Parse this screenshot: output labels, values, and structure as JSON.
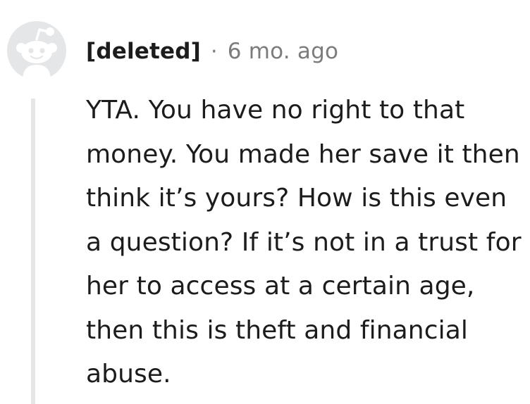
{
  "comment": {
    "author": "[deleted]",
    "separator": "·",
    "timestamp": "6 mo. ago",
    "body": "YTA. You have no right to that money. You made her save it then think it’s yours? How is this even a question? If it’s not in a trust for her to access at a certain age, then this is theft and financial abuse.",
    "avatar_icon": "reddit-snoo-avatar-icon",
    "colors": {
      "text": "#1c1c1c",
      "meta": "#7c7c7c",
      "avatar_bg": "#e4e6e8",
      "thread_line": "#e6e6e6"
    }
  }
}
